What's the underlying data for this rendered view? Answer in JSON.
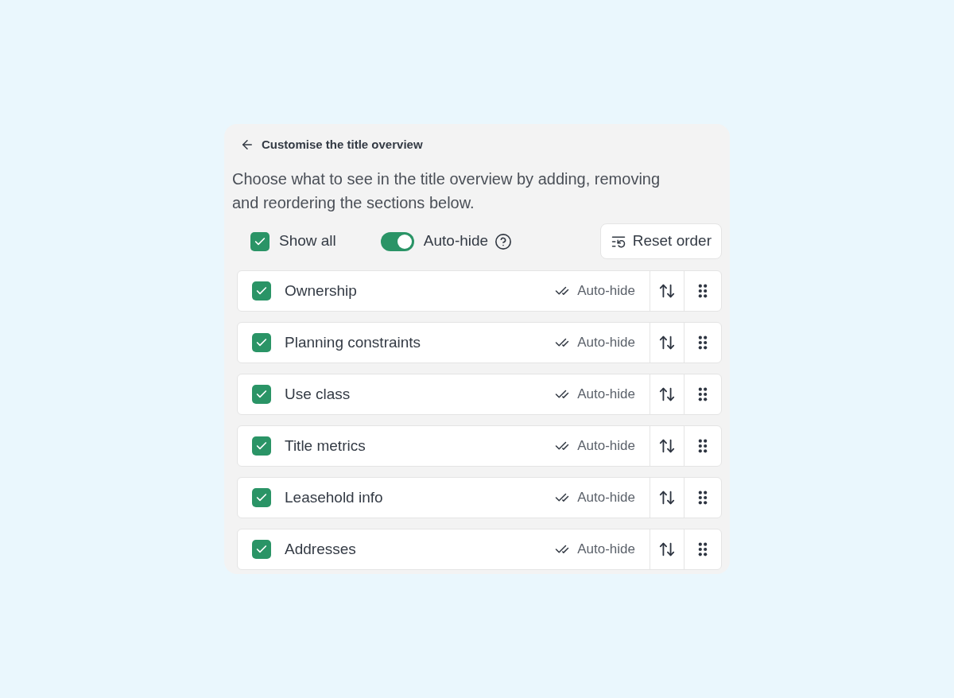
{
  "header": {
    "title": "Customise the title overview"
  },
  "description": "Choose what to see in the title overview by adding, removing and reordering the sections below.",
  "controls": {
    "show_all": {
      "label": "Show all",
      "checked": true
    },
    "auto_hide": {
      "label": "Auto-hide",
      "on": true
    },
    "reset_button": {
      "label": "Reset order"
    }
  },
  "sections": [
    {
      "label": "Ownership",
      "checked": true,
      "auto_hide_label": "Auto-hide"
    },
    {
      "label": "Planning constraints",
      "checked": true,
      "auto_hide_label": "Auto-hide"
    },
    {
      "label": "Use class",
      "checked": true,
      "auto_hide_label": "Auto-hide"
    },
    {
      "label": "Title metrics",
      "checked": true,
      "auto_hide_label": "Auto-hide"
    },
    {
      "label": "Leasehold info",
      "checked": true,
      "auto_hide_label": "Auto-hide"
    },
    {
      "label": "Addresses",
      "checked": true,
      "auto_hide_label": "Auto-hide"
    }
  ]
}
